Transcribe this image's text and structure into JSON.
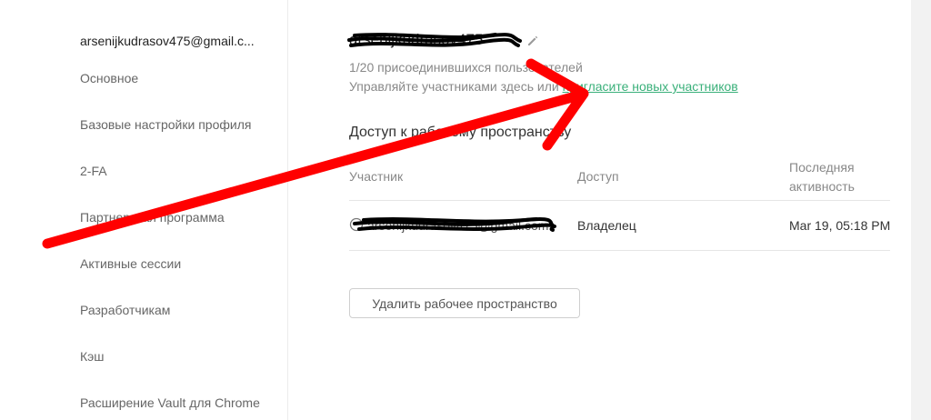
{
  "sidebar": {
    "account_email": "arsenijkudrasov475@gmail.c...",
    "items": [
      {
        "label": "Основное"
      },
      {
        "label": "Базовые настройки профиля"
      },
      {
        "label": "2-FA"
      },
      {
        "label": "Партнерская программа"
      },
      {
        "label": "Активные сессии"
      },
      {
        "label": "Разработчикам"
      },
      {
        "label": "Кэш"
      },
      {
        "label": "Расширение Vault для Chrome"
      }
    ]
  },
  "workspace": {
    "name": "arsenijkudrasov475",
    "edit_icon": "pencil-icon",
    "joined_text": "1/20 присоединившихся пользователей",
    "manage_text": "Управляйте участниками здесь или",
    "invite_link": "пригласите новых участников"
  },
  "access": {
    "title": "Доступ к рабочему пространству",
    "columns": {
      "member": "Участник",
      "access": "Доступ",
      "last_activity_line1": "Последняя",
      "last_activity_line2": "активность"
    },
    "rows": [
      {
        "member_email": "arsenijkudrasov475@gmail.com",
        "access": "Владелец",
        "last_activity": "Mar 19, 05:18 PM"
      }
    ]
  },
  "actions": {
    "delete_label": "Удалить рабочее пространство"
  },
  "colors": {
    "accent_link": "#3ab07a",
    "annotation_arrow": "#ff0000",
    "redaction": "#000000"
  }
}
